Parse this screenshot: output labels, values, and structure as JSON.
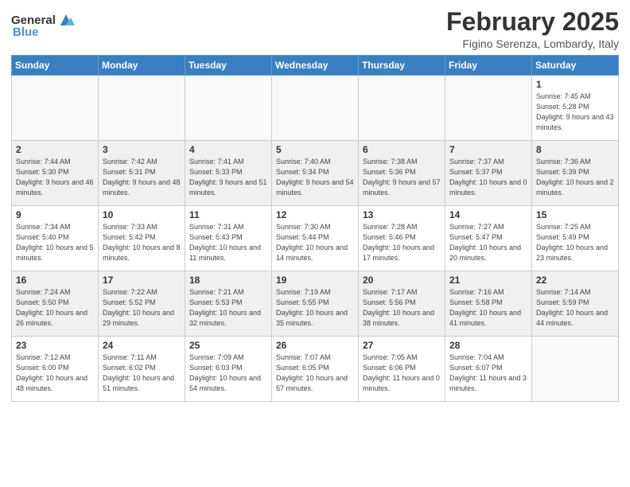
{
  "header": {
    "logo_general": "General",
    "logo_blue": "Blue",
    "month_title": "February 2025",
    "location": "Figino Serenza, Lombardy, Italy"
  },
  "days_of_week": [
    "Sunday",
    "Monday",
    "Tuesday",
    "Wednesday",
    "Thursday",
    "Friday",
    "Saturday"
  ],
  "weeks": [
    {
      "shaded": false,
      "days": [
        {
          "num": "",
          "info": ""
        },
        {
          "num": "",
          "info": ""
        },
        {
          "num": "",
          "info": ""
        },
        {
          "num": "",
          "info": ""
        },
        {
          "num": "",
          "info": ""
        },
        {
          "num": "",
          "info": ""
        },
        {
          "num": "1",
          "info": "Sunrise: 7:45 AM\nSunset: 5:28 PM\nDaylight: 9 hours and 43 minutes."
        }
      ]
    },
    {
      "shaded": true,
      "days": [
        {
          "num": "2",
          "info": "Sunrise: 7:44 AM\nSunset: 5:30 PM\nDaylight: 9 hours and 46 minutes."
        },
        {
          "num": "3",
          "info": "Sunrise: 7:42 AM\nSunset: 5:31 PM\nDaylight: 9 hours and 48 minutes."
        },
        {
          "num": "4",
          "info": "Sunrise: 7:41 AM\nSunset: 5:33 PM\nDaylight: 9 hours and 51 minutes."
        },
        {
          "num": "5",
          "info": "Sunrise: 7:40 AM\nSunset: 5:34 PM\nDaylight: 9 hours and 54 minutes."
        },
        {
          "num": "6",
          "info": "Sunrise: 7:38 AM\nSunset: 5:36 PM\nDaylight: 9 hours and 57 minutes."
        },
        {
          "num": "7",
          "info": "Sunrise: 7:37 AM\nSunset: 5:37 PM\nDaylight: 10 hours and 0 minutes."
        },
        {
          "num": "8",
          "info": "Sunrise: 7:36 AM\nSunset: 5:39 PM\nDaylight: 10 hours and 2 minutes."
        }
      ]
    },
    {
      "shaded": false,
      "days": [
        {
          "num": "9",
          "info": "Sunrise: 7:34 AM\nSunset: 5:40 PM\nDaylight: 10 hours and 5 minutes."
        },
        {
          "num": "10",
          "info": "Sunrise: 7:33 AM\nSunset: 5:42 PM\nDaylight: 10 hours and 8 minutes."
        },
        {
          "num": "11",
          "info": "Sunrise: 7:31 AM\nSunset: 5:43 PM\nDaylight: 10 hours and 11 minutes."
        },
        {
          "num": "12",
          "info": "Sunrise: 7:30 AM\nSunset: 5:44 PM\nDaylight: 10 hours and 14 minutes."
        },
        {
          "num": "13",
          "info": "Sunrise: 7:28 AM\nSunset: 5:46 PM\nDaylight: 10 hours and 17 minutes."
        },
        {
          "num": "14",
          "info": "Sunrise: 7:27 AM\nSunset: 5:47 PM\nDaylight: 10 hours and 20 minutes."
        },
        {
          "num": "15",
          "info": "Sunrise: 7:25 AM\nSunset: 5:49 PM\nDaylight: 10 hours and 23 minutes."
        }
      ]
    },
    {
      "shaded": true,
      "days": [
        {
          "num": "16",
          "info": "Sunrise: 7:24 AM\nSunset: 5:50 PM\nDaylight: 10 hours and 26 minutes."
        },
        {
          "num": "17",
          "info": "Sunrise: 7:22 AM\nSunset: 5:52 PM\nDaylight: 10 hours and 29 minutes."
        },
        {
          "num": "18",
          "info": "Sunrise: 7:21 AM\nSunset: 5:53 PM\nDaylight: 10 hours and 32 minutes."
        },
        {
          "num": "19",
          "info": "Sunrise: 7:19 AM\nSunset: 5:55 PM\nDaylight: 10 hours and 35 minutes."
        },
        {
          "num": "20",
          "info": "Sunrise: 7:17 AM\nSunset: 5:56 PM\nDaylight: 10 hours and 38 minutes."
        },
        {
          "num": "21",
          "info": "Sunrise: 7:16 AM\nSunset: 5:58 PM\nDaylight: 10 hours and 41 minutes."
        },
        {
          "num": "22",
          "info": "Sunrise: 7:14 AM\nSunset: 5:59 PM\nDaylight: 10 hours and 44 minutes."
        }
      ]
    },
    {
      "shaded": false,
      "days": [
        {
          "num": "23",
          "info": "Sunrise: 7:12 AM\nSunset: 6:00 PM\nDaylight: 10 hours and 48 minutes."
        },
        {
          "num": "24",
          "info": "Sunrise: 7:11 AM\nSunset: 6:02 PM\nDaylight: 10 hours and 51 minutes."
        },
        {
          "num": "25",
          "info": "Sunrise: 7:09 AM\nSunset: 6:03 PM\nDaylight: 10 hours and 54 minutes."
        },
        {
          "num": "26",
          "info": "Sunrise: 7:07 AM\nSunset: 6:05 PM\nDaylight: 10 hours and 57 minutes."
        },
        {
          "num": "27",
          "info": "Sunrise: 7:05 AM\nSunset: 6:06 PM\nDaylight: 11 hours and 0 minutes."
        },
        {
          "num": "28",
          "info": "Sunrise: 7:04 AM\nSunset: 6:07 PM\nDaylight: 11 hours and 3 minutes."
        },
        {
          "num": "",
          "info": ""
        }
      ]
    }
  ]
}
